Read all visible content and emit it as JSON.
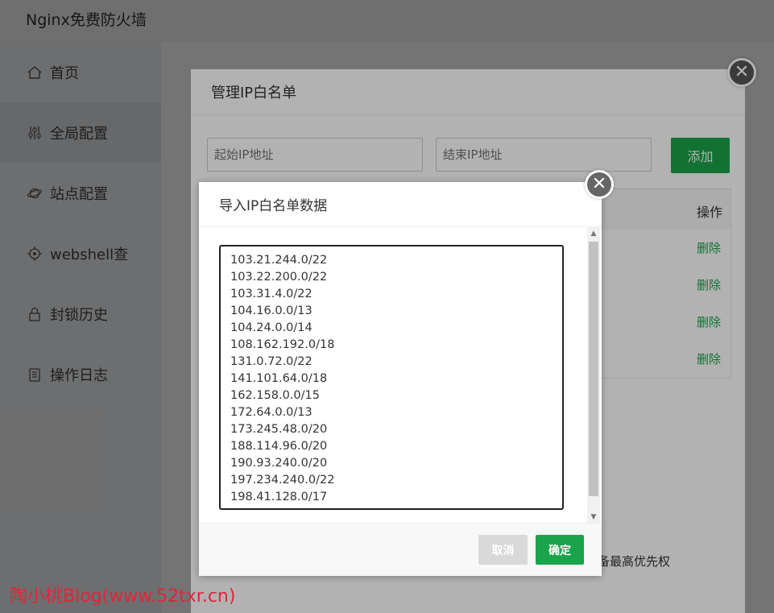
{
  "app": {
    "title": "Nginx免费防火墙"
  },
  "sidebar": {
    "items": [
      {
        "label": "首页",
        "icon": "home-icon"
      },
      {
        "label": "全局配置",
        "icon": "sliders-icon",
        "active": true
      },
      {
        "label": "站点配置",
        "icon": "planet-icon"
      },
      {
        "label": "webshell查",
        "icon": "target-icon"
      },
      {
        "label": "封锁历史",
        "icon": "lock-icon"
      },
      {
        "label": "操作日志",
        "icon": "log-icon"
      }
    ]
  },
  "outer_modal": {
    "title": "管理IP白名单",
    "start_ip_placeholder": "起始IP地址",
    "end_ip_placeholder": "结束IP地址",
    "add_label": "添加",
    "ops_header": "操作",
    "delete_labels": [
      "删除",
      "删除",
      "删除",
      "删除"
    ],
    "footnote": "备最高优先权"
  },
  "inner_modal": {
    "title": "导入IP白名单数据",
    "ip_list": "103.21.244.0/22\n103.22.200.0/22\n103.31.4.0/22\n104.16.0.0/13\n104.24.0.0/14\n108.162.192.0/18\n131.0.72.0/22\n141.101.64.0/18\n162.158.0.0/15\n172.64.0.0/13\n173.245.48.0/20\n188.114.96.0/20\n190.93.240.0/20\n197.234.240.0/22\n198.41.128.0/17",
    "cancel_label": "取消",
    "ok_label": "确定"
  },
  "watermark": "陶小桃Blog(www.52txr.cn)",
  "colors": {
    "accent": "#1aa34a"
  }
}
